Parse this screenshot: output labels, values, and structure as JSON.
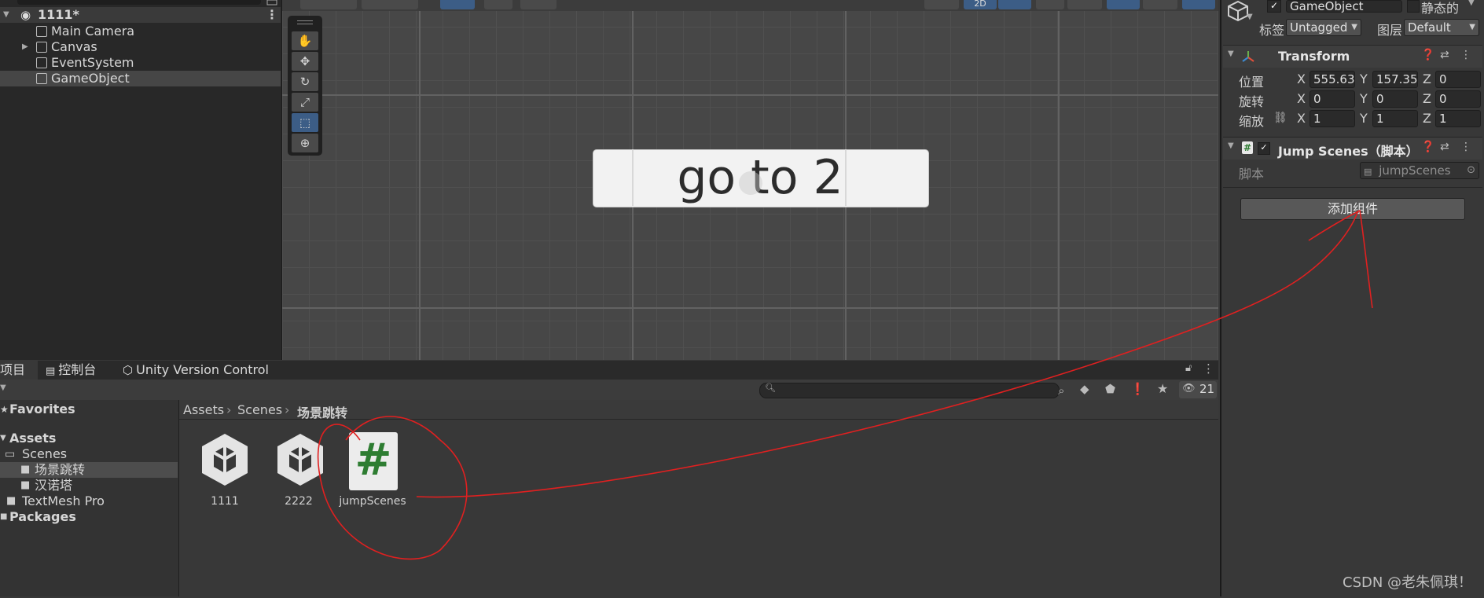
{
  "hierarchy": {
    "scene_name": "1111*",
    "items": [
      {
        "label": "Main Camera",
        "expandable": false
      },
      {
        "label": "Canvas",
        "expandable": true
      },
      {
        "label": "EventSystem",
        "expandable": false
      },
      {
        "label": "GameObject",
        "expandable": false,
        "selected": true
      }
    ]
  },
  "scene": {
    "button_text": "go to 2",
    "topbar_labels": [
      "2D"
    ],
    "tools": [
      "hand-tool",
      "move-tool",
      "rotate-tool",
      "scale-tool",
      "rect-tool",
      "transform-tool"
    ],
    "active_tool": "rect-tool"
  },
  "inspector": {
    "object_name": "GameObject",
    "static_label": "静态的",
    "tag_label": "标签",
    "tag_value": "Untagged",
    "layer_label": "图层",
    "layer_value": "Default",
    "transform": {
      "title": "Transform",
      "position_label": "位置",
      "rotation_label": "旋转",
      "scale_label": "缩放",
      "position": {
        "x": "555.63",
        "y": "157.35",
        "z": "0"
      },
      "rotation": {
        "x": "0",
        "y": "0",
        "z": "0"
      },
      "scale": {
        "x": "1",
        "y": "1",
        "z": "1"
      },
      "axis_x": "X",
      "axis_y": "Y",
      "axis_z": "Z"
    },
    "script_component": {
      "title": "Jump Scenes（脚本）",
      "script_label": "脚本",
      "script_value": "jumpScenes"
    },
    "add_component_label": "添加组件"
  },
  "project": {
    "tabs": [
      {
        "label": "项目",
        "icon": "folder-icon"
      },
      {
        "label": "控制台",
        "icon": "console-icon"
      },
      {
        "label": "Unity Version Control",
        "icon": "version-control-icon"
      }
    ],
    "hidden_count": "21",
    "tree": [
      {
        "label": "Favorites",
        "bold": true
      },
      {
        "label": "Assets",
        "bold": true
      },
      {
        "label": "Scenes",
        "bold": false
      },
      {
        "label": "场景跳转",
        "bold": false,
        "selected": true
      },
      {
        "label": "汉诺塔",
        "bold": false
      },
      {
        "label": "TextMesh Pro",
        "bold": false
      },
      {
        "label": "Packages",
        "bold": true
      }
    ],
    "breadcrumb": [
      "Assets",
      "Scenes",
      "场景跳转"
    ],
    "assets": [
      {
        "name": "1111",
        "icon": "unity-scene-icon"
      },
      {
        "name": "2222",
        "icon": "unity-scene-icon"
      },
      {
        "name": "jumpScenes",
        "icon": "csharp-script-icon"
      }
    ]
  },
  "watermark": "CSDN @老朱佩琪！",
  "colors": {
    "annotation": "#e02020",
    "script_hash": "#2e7d32",
    "active_tool": "#3c5d86"
  }
}
